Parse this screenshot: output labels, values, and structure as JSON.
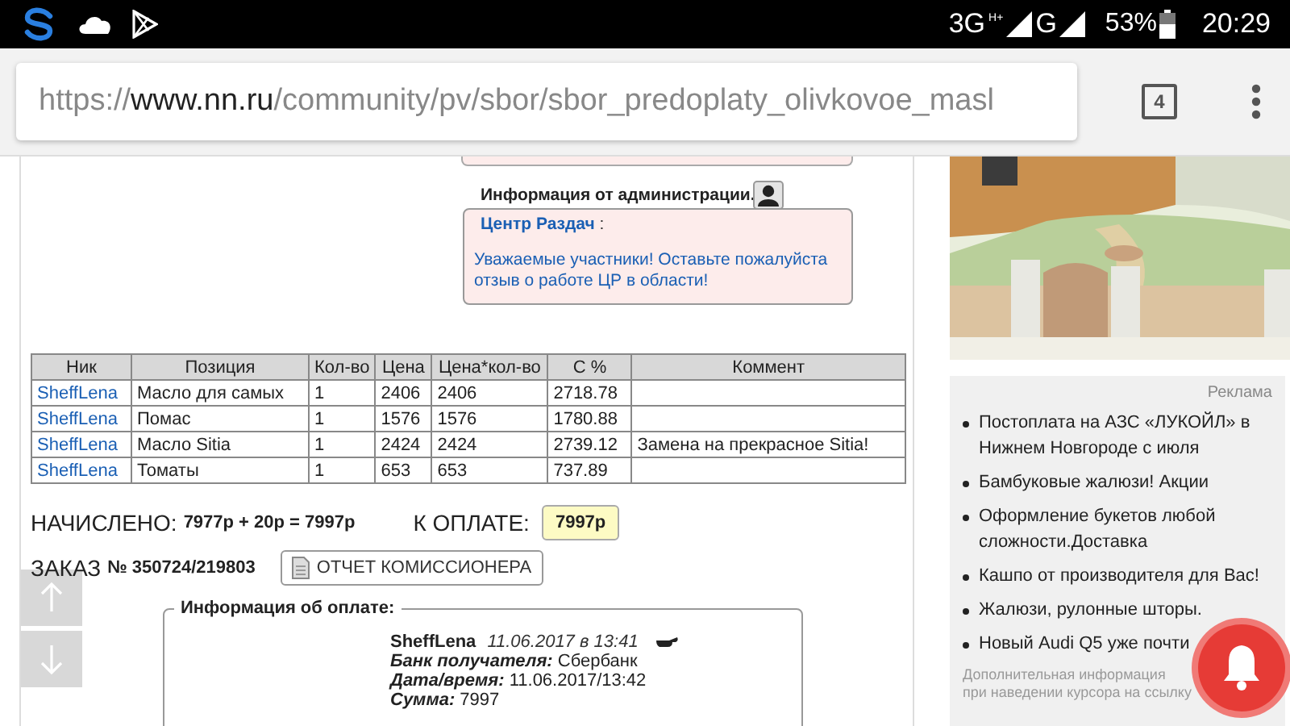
{
  "status_bar": {
    "network_1": "3G",
    "network_1_badge": "H+",
    "network_2": "G",
    "battery": "53%",
    "time": "20:29"
  },
  "address_bar": {
    "scheme": "https://",
    "host": "www.nn.ru",
    "path": "/community/pv/sbor/sbor_predoplaty_olivkovoe_masl",
    "tab_count": "4"
  },
  "admin_notice": {
    "title": "Информация от администрации.",
    "author": "Центр Раздач",
    "separator": ":",
    "message": "Уважаемые участники! Оставьте пожалуйста отзыв о работе ЦР в области!"
  },
  "table": {
    "columns": [
      "Ник",
      "Позиция",
      "Кол-во",
      "Цена",
      "Цена*кол-во",
      "С %",
      "Коммент"
    ],
    "rows": [
      {
        "nick": "SheffLena",
        "position": "Масло для самых",
        "qty": "1",
        "price": "2406",
        "total": "2406",
        "c_pct": "2718.78"
      },
      {
        "nick": "SheffLena",
        "position": "Помас",
        "qty": "1",
        "price": "1576",
        "total": "1576",
        "c_pct": "1780.88"
      },
      {
        "nick": "SheffLena",
        "position": "Масло Sitia",
        "qty": "1",
        "price": "2424",
        "total": "2424",
        "c_pct": "2739.12",
        "comment": "Замена на прекрасное Sitia!"
      },
      {
        "nick": "SheffLena",
        "position": "Томаты",
        "qty": "1",
        "price": "653",
        "total": "653",
        "c_pct": "737.89"
      }
    ]
  },
  "totals": {
    "charged_label": "НАЧИСЛЕНО:",
    "charged_value": "7977р + 20р = 7997р",
    "pay_label": "К ОПЛАТЕ:",
    "pay_value": "7997р"
  },
  "order": {
    "label": "ЗАКАЗ",
    "number": "№ 350724/219803",
    "report_button": "ОТЧЕТ КОМИССИОНЕРА"
  },
  "payment_info": {
    "legend": "Информация об оплате:",
    "user": "SheffLena",
    "datetime": "11.06.2017 в 13:41",
    "fields": [
      {
        "label": "Банк получателя:",
        "value": "Сбербанк"
      },
      {
        "label": "Дата/время:",
        "value": "11.06.2017/13:42"
      },
      {
        "label": "Сумма:",
        "value": "7997"
      }
    ]
  },
  "sidebar": {
    "ads": {
      "label": "Реклама",
      "items": [
        "Постоплата на АЗС «ЛУКОЙЛ» в Нижнем Новгороде с июля",
        "Бамбуковые жалюзи! Акции",
        "Оформление букетов любой сложности.Доставка",
        "Кашпо от производителя для Вас!",
        "Жалюзи, рулонные шторы.",
        "Новый Audi Q5 уже почти"
      ],
      "footnote_lines": [
        "Дополнительная информация",
        "при наведении курсора на ссылку"
      ]
    }
  }
}
